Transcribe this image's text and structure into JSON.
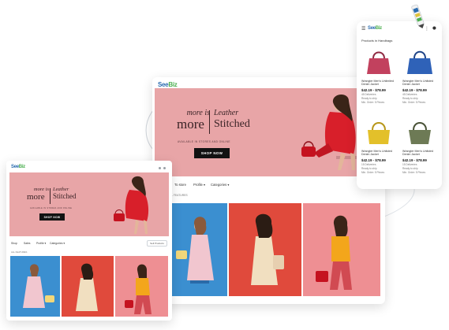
{
  "colors": {
    "banner": "#e8a5a7",
    "tile_blue": "#3b8fd0",
    "tile_red": "#e04a3c",
    "tile_pink": "#ee8f93",
    "logo_blue": "#2b6cb0",
    "logo_green": "#4caf50"
  },
  "brand": {
    "see": "See",
    "biz": "Biz",
    "tagline": ""
  },
  "hero": {
    "more_is": "more is",
    "more": "more",
    "leather": "Leather",
    "stitched": "Stitched",
    "subtitle": "AVAILABLE IN STORES AND ONLINE",
    "shop_now": "SHOP NOW"
  },
  "desktop_nav": {
    "item1": "To store",
    "item2": "Profile ▾",
    "item3": "Categories ▾",
    "section": "ALL FEATURES"
  },
  "laptop_nav": {
    "item1": "Shop",
    "item2": "Sales",
    "item3": "Profile ▾",
    "item4": "Categories ▾",
    "action": "Sell Products",
    "section": "ALL FEATURES"
  },
  "icons": {
    "menu": "hamburger-icon",
    "user": "user-icon",
    "more": "more-vertical-icon",
    "pen": "stylus-icon"
  },
  "phone": {
    "title": "Products in Handbags",
    "products": [
      {
        "name": "Wrangler Men's Unlimited Denim Jacket",
        "price": "$42.19 - $78.99",
        "meta1": "45 Deliveries",
        "meta2": "Ready to ship",
        "meta3": "Min. Order: 5 Pieces",
        "bag": "pink"
      },
      {
        "name": "Wrangler Men's Unlisted Denim Jacket",
        "price": "$42.19 - $78.99",
        "meta1": "45 Deliveries",
        "meta2": "Ready to ship",
        "meta3": "Min. Order: 5 Pieces",
        "bag": "blue"
      },
      {
        "name": "Wrangler Men's Unlisted Denim Jacket",
        "price": "$42.19 - $78.99",
        "meta1": "15 Deliveries",
        "meta2": "Ready to ship",
        "meta3": "Min. Order: 5 Pieces",
        "bag": "yellow"
      },
      {
        "name": "Wrangler Men's Unlisted Denim Jacket",
        "price": "$42.19 - $78.99",
        "meta1": "15 Deliveries",
        "meta2": "Ready to ship",
        "meta3": "Min. Order: 5 Pieces",
        "bag": "olive"
      }
    ]
  }
}
